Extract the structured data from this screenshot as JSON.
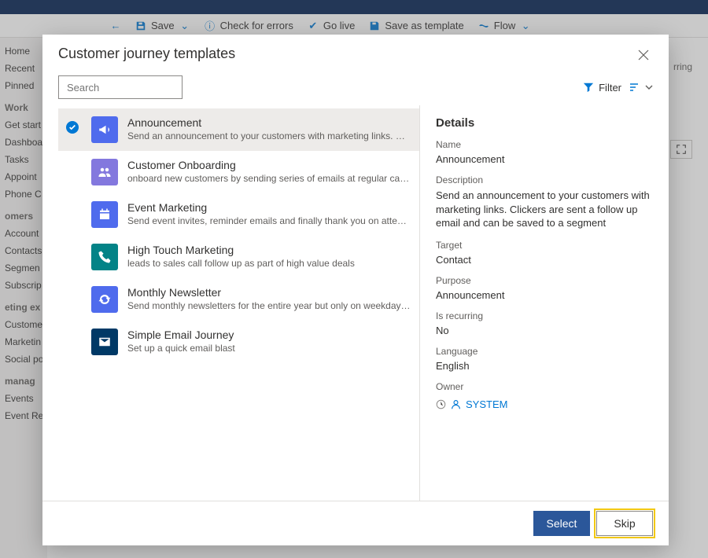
{
  "bg": {
    "toolbar": {
      "back": "←",
      "save": "Save",
      "checkErrors": "Check for errors",
      "goLive": "Go live",
      "saveAsTemplate": "Save as template",
      "flow": "Flow"
    },
    "cornerLabel": "rring",
    "sidebar": {
      "items1": [
        "Home",
        "Recent",
        "Pinned"
      ],
      "head1": "Work",
      "items2": [
        "Get start",
        "Dashboa",
        "Tasks",
        "Appoint",
        "Phone C"
      ],
      "head2": "omers",
      "items3": [
        "Account",
        "Contacts",
        "Segmen",
        "Subscrip"
      ],
      "head3": "eting ex",
      "items4": [
        "Custome",
        "Marketin",
        "Social po"
      ],
      "head4": "manag",
      "items5": [
        "Events",
        "Event Registrations"
      ]
    }
  },
  "modal": {
    "title": "Customer journey templates",
    "searchPlaceholder": "Search",
    "filterLabel": "Filter",
    "templates": [
      {
        "title": "Announcement",
        "desc": "Send an announcement to your customers with marketing links. Clickers are sent a follow up email and can be saved to a segment",
        "iconClass": "ic-blue",
        "iconKey": "megaphone"
      },
      {
        "title": "Customer Onboarding",
        "desc": "onboard new customers by sending series of emails at regular cadence",
        "iconClass": "ic-purple",
        "iconKey": "people"
      },
      {
        "title": "Event Marketing",
        "desc": "Send event invites, reminder emails and finally thank you on attending",
        "iconClass": "ic-blue2",
        "iconKey": "calendar"
      },
      {
        "title": "High Touch Marketing",
        "desc": "leads to sales call follow up as part of high value deals",
        "iconClass": "ic-teal",
        "iconKey": "phone"
      },
      {
        "title": "Monthly Newsletter",
        "desc": "Send monthly newsletters for the entire year but only on weekday afternoons",
        "iconClass": "ic-blue3",
        "iconKey": "cycle"
      },
      {
        "title": "Simple Email Journey",
        "desc": "Set up a quick email blast",
        "iconClass": "ic-navy",
        "iconKey": "envelope"
      }
    ],
    "details": {
      "heading": "Details",
      "labels": {
        "name": "Name",
        "description": "Description",
        "target": "Target",
        "purpose": "Purpose",
        "isRecurring": "Is recurring",
        "language": "Language",
        "owner": "Owner"
      },
      "values": {
        "name": "Announcement",
        "description": "Send an announcement to your customers with marketing links. Clickers are sent a follow up email and can be saved to a segment",
        "target": "Contact",
        "purpose": "Announcement",
        "isRecurring": "No",
        "language": "English",
        "owner": "SYSTEM"
      }
    },
    "buttons": {
      "select": "Select",
      "skip": "Skip"
    }
  }
}
